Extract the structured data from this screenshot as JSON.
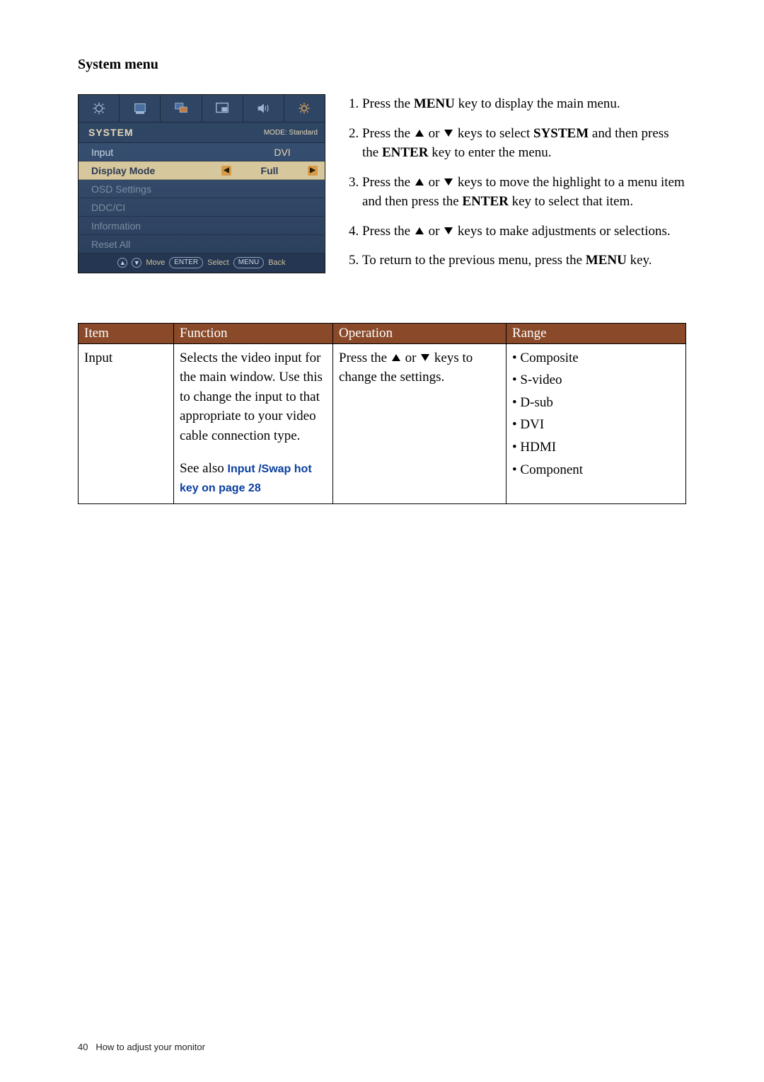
{
  "section_title": "System menu",
  "osd": {
    "title": "SYSTEM",
    "mode_label": "MODE: Standard",
    "rows": [
      {
        "label": "Input",
        "value": "DVI",
        "highlight": false,
        "arrows": false,
        "dim": false
      },
      {
        "label": "Display Mode",
        "value": "Full",
        "highlight": true,
        "arrows": true,
        "dim": false
      },
      {
        "label": "OSD Settings",
        "value": "",
        "highlight": false,
        "arrows": false,
        "dim": true
      },
      {
        "label": "DDC/CI",
        "value": "",
        "highlight": false,
        "arrows": false,
        "dim": true
      },
      {
        "label": "Information",
        "value": "",
        "highlight": false,
        "arrows": false,
        "dim": true
      },
      {
        "label": "Reset All",
        "value": "",
        "highlight": false,
        "arrows": false,
        "dim": true
      }
    ],
    "footer": {
      "up": "▲",
      "down": "▼",
      "move": "Move",
      "enter_pill": "ENTER",
      "select": "Select",
      "menu_pill": "MENU",
      "back": "Back"
    }
  },
  "steps": {
    "s1_a": "Press the ",
    "s1_menu": "MENU",
    "s1_b": " key to display the main menu.",
    "s2_a": "Press the ",
    "s2_or": " or ",
    "s2_b": " keys to select ",
    "s2_system": "SYSTEM",
    "s2_c": " and then press the ",
    "s2_enter": "ENTER",
    "s2_d": " key to enter the menu.",
    "s3_a": "Press the ",
    "s3_or": " or ",
    "s3_b": " keys to move the highlight to a menu item and then press the ",
    "s3_enter": "ENTER",
    "s3_c": " key to select that item.",
    "s4_a": "Press the ",
    "s4_or": " or ",
    "s4_b": " keys to make adjustments or selections.",
    "s5_a": "To return to the previous menu, press the ",
    "s5_menu": "MENU",
    "s5_b": " key."
  },
  "table": {
    "headers": {
      "item": "Item",
      "function": "Function",
      "operation": "Operation",
      "range": "Range"
    },
    "row": {
      "item": "Input",
      "function_main": "Selects the video input for the main window. Use this to change the input to that appropriate to your video cable connection type.",
      "function_seealso_prefix": "See also ",
      "function_link": "Input /Swap hot key on page 28",
      "operation_a": "Press the ",
      "operation_or": " or ",
      "operation_b": " keys to change the settings.",
      "range": [
        "Composite",
        "S-video",
        "D-sub",
        "DVI",
        "HDMI",
        "Component"
      ]
    }
  },
  "footer": {
    "page_num": "40",
    "chapter": "How to adjust your monitor"
  }
}
